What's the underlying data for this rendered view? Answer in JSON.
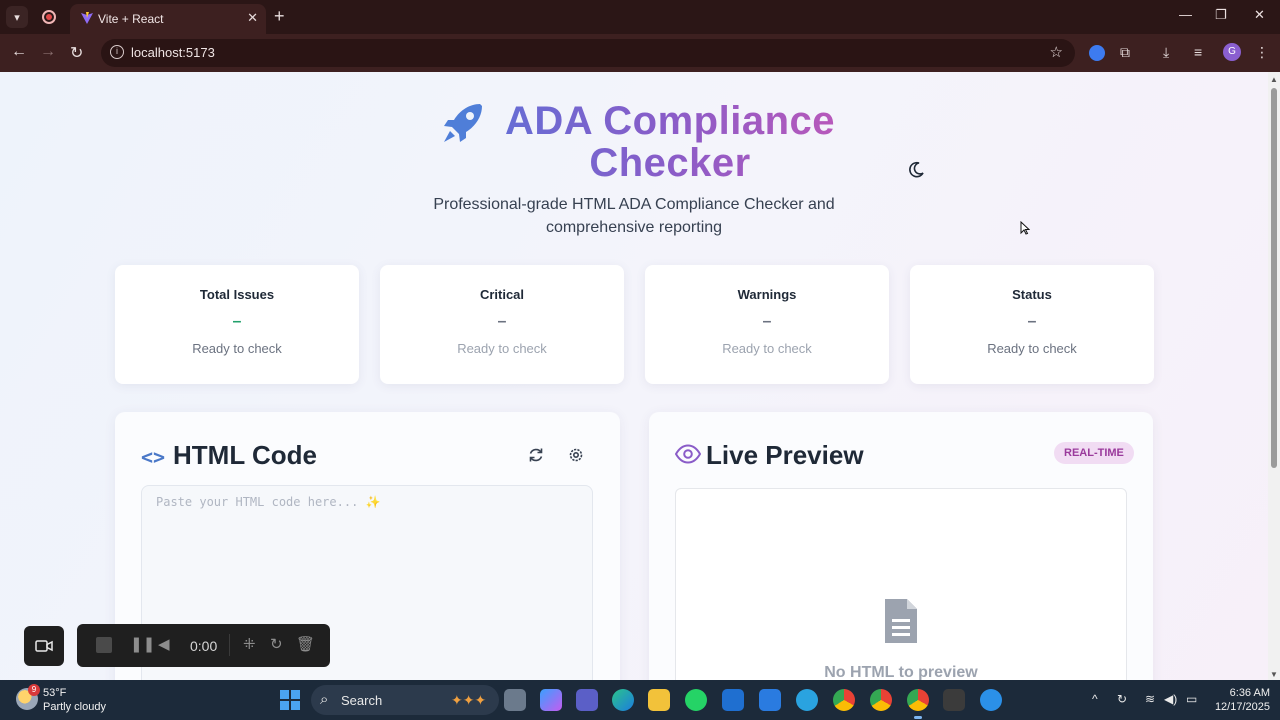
{
  "browser": {
    "tab_title": "Vite + React",
    "url": "localhost:5173",
    "profile_initial": "G"
  },
  "header": {
    "title": "ADA Compliance Checker",
    "subtitle": "Professional-grade HTML ADA Compliance Checker and comprehensive reporting"
  },
  "stats": [
    {
      "title": "Total Issues",
      "value": "–",
      "label": "Ready to check"
    },
    {
      "title": "Critical",
      "value": "–",
      "label": "Ready to check"
    },
    {
      "title": "Warnings",
      "value": "–",
      "label": "Ready to check"
    },
    {
      "title": "Status",
      "value": "–",
      "label": "Ready to check"
    }
  ],
  "code_panel": {
    "title": "HTML Code",
    "placeholder": "Paste your HTML code here... ✨"
  },
  "preview_panel": {
    "title": "Live Preview",
    "badge": "REAL-TIME",
    "empty_text": "No HTML to preview"
  },
  "recorder": {
    "time": "0:00"
  },
  "taskbar": {
    "weather_badge": "9",
    "temperature": "53°F",
    "weather": "Partly cloudy",
    "search_label": "Search",
    "time": "6:36 AM",
    "date": "12/17/2025"
  },
  "colors": {
    "accent_gradient": [
      "#5b72d8",
      "#8a5cc8",
      "#c657b6"
    ],
    "badge_bg": "#f1dcf3",
    "badge_text": "#9a3a9c",
    "browser_frame": "#3d2020"
  }
}
